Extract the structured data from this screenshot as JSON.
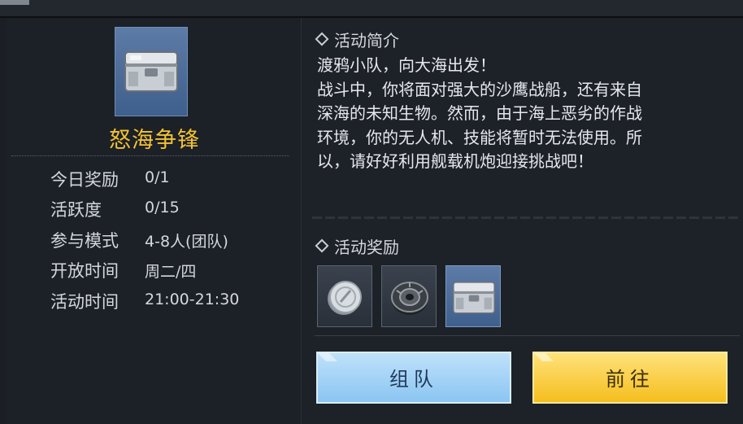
{
  "activity": {
    "name": "怒海争锋",
    "icon": "supply-chest-icon"
  },
  "info": [
    {
      "label": "今日奖励",
      "value": "0/1"
    },
    {
      "label": "活跃度",
      "value": "0/15"
    },
    {
      "label": "参与模式",
      "value": "4-8人(团队)"
    },
    {
      "label": "开放时间",
      "value": "周二/四"
    },
    {
      "label": "活动时间",
      "value": "21:00-21:30"
    }
  ],
  "intro": {
    "title": "活动简介",
    "lines": [
      "渡鸦小队，向大海出发！",
      "战斗中，你将面对强大的沙鹰战船，还有来自",
      "深海的未知生物。然而，由于海上恶劣的作战",
      "环境，你的无人机、技能将暂时无法使用。所",
      "以，请好好利用舰载机炮迎接挑战吧！"
    ]
  },
  "rewards": {
    "title": "活动奖励",
    "items": [
      {
        "icon": "silver-coin-icon"
      },
      {
        "icon": "gear-part-icon"
      },
      {
        "icon": "supply-chest-icon"
      }
    ]
  },
  "buttons": {
    "team": "组队",
    "go": "前往"
  },
  "colors": {
    "title_gold": "#f2c233",
    "team_button": "#8bc5f2",
    "go_button": "#f5be1e"
  }
}
